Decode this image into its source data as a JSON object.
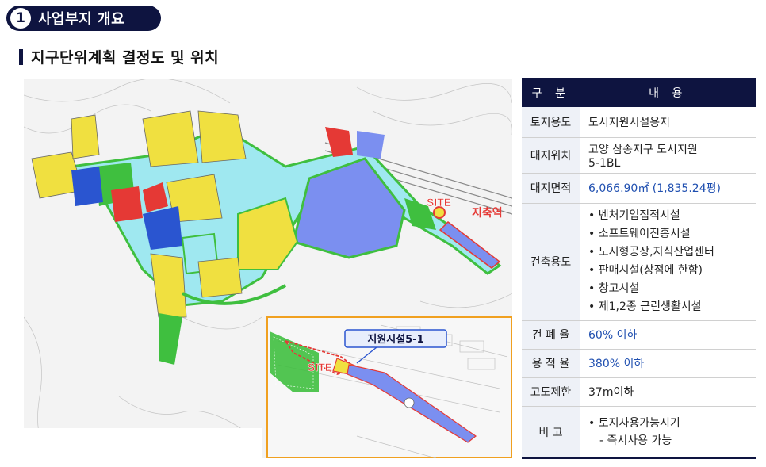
{
  "section": {
    "number": "1",
    "title": "사업부지 개요"
  },
  "subtitle": "지구단위계획 결정도 및 위치",
  "map": {
    "site_label": "SITE",
    "station_label": "지축역",
    "inset_callout": "지원시설5-1",
    "inset_site_label": "SITE",
    "colors": {
      "commercial": "#e53935",
      "residential": "#f0e040",
      "park": "#3fbf3f",
      "road": "#9fe8f0",
      "support": "#7b8ff0",
      "school": "#2a55d0"
    }
  },
  "table": {
    "header": {
      "col1": "구 분",
      "col2": "내 용"
    },
    "rows": {
      "land_use": {
        "label": "토지용도",
        "value": "도시지원시설용지"
      },
      "location": {
        "label": "대지위치",
        "value_line1": "고양 삼송지구 도시지원",
        "value_line2": "5-1BL"
      },
      "area": {
        "label": "대지면적",
        "value": "6,066.90㎡ (1,835.24평)"
      },
      "building_use": {
        "label": "건축용도",
        "items": [
          "• 벤처기업집적시설",
          "• 소프트웨어진흥시설",
          "• 도시형공장,지식산업센터",
          "• 판매시설(상점에 한함)",
          "• 창고시설",
          "• 제1,2종 근린생활시설"
        ]
      },
      "coverage": {
        "label": "건 폐 율",
        "value": "60% 이하"
      },
      "far": {
        "label": "용 적 율",
        "value": "380% 이하"
      },
      "height": {
        "label": "고도제한",
        "value": "37m이하"
      },
      "remarks": {
        "label": "비   고",
        "line1": "• 토지사용가능시기",
        "line2": "- 즉시사용 가능"
      }
    }
  }
}
